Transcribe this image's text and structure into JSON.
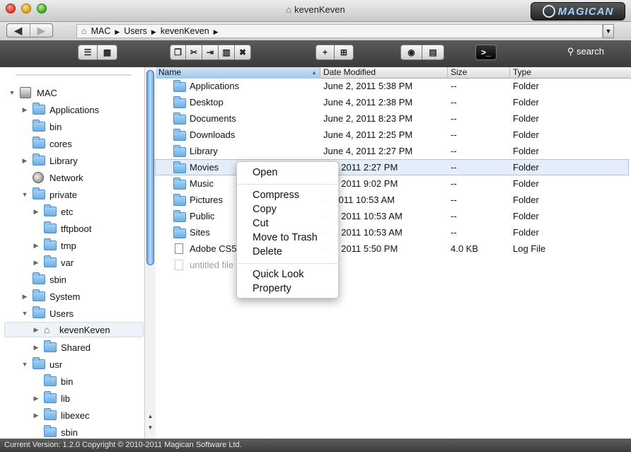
{
  "window": {
    "title": "kevenKeven",
    "brand": "MAGICAN"
  },
  "path": {
    "segments": [
      "MAC",
      "Users",
      "kevenKeven"
    ]
  },
  "toolbar": {
    "search_label": "search"
  },
  "sidebar": {
    "items": [
      {
        "label": "MAC"
      },
      {
        "label": "Applications"
      },
      {
        "label": "bin"
      },
      {
        "label": "cores"
      },
      {
        "label": "Library"
      },
      {
        "label": "Network"
      },
      {
        "label": "private"
      },
      {
        "label": "etc"
      },
      {
        "label": "tftpboot"
      },
      {
        "label": "tmp"
      },
      {
        "label": "var"
      },
      {
        "label": "sbin"
      },
      {
        "label": "System"
      },
      {
        "label": "Users"
      },
      {
        "label": "kevenKeven"
      },
      {
        "label": "Shared"
      },
      {
        "label": "usr"
      },
      {
        "label": "bin"
      },
      {
        "label": "lib"
      },
      {
        "label": "libexec"
      },
      {
        "label": "sbin"
      }
    ]
  },
  "columns": [
    "Name",
    "Date Modified",
    "Size",
    "Type"
  ],
  "files": [
    {
      "name": "Applications",
      "date": "June 2, 2011 5:38 PM",
      "size": "--",
      "type": "Folder"
    },
    {
      "name": "Desktop",
      "date": "June 4, 2011 2:38 PM",
      "size": "--",
      "type": "Folder"
    },
    {
      "name": "Documents",
      "date": "June 2, 2011 8:23 PM",
      "size": "--",
      "type": "Folder"
    },
    {
      "name": "Downloads",
      "date": "June 4, 2011 2:25 PM",
      "size": "--",
      "type": "Folder"
    },
    {
      "name": "Library",
      "date": "June 4, 2011 2:27 PM",
      "size": "--",
      "type": "Folder"
    },
    {
      "name": "Movies",
      "date": "e 4, 2011 2:27 PM",
      "size": "--",
      "type": "Folder"
    },
    {
      "name": "Music",
      "date": "e 2, 2011 9:02 PM",
      "size": "--",
      "type": "Folder"
    },
    {
      "name": "Pictures",
      "date": "2, 2011 10:53 AM",
      "size": "--",
      "type": "Folder"
    },
    {
      "name": "Public",
      "date": "e 2, 2011 10:53 AM",
      "size": "--",
      "type": "Folder"
    },
    {
      "name": "Sites",
      "date": "e 2, 2011 10:53 AM",
      "size": "--",
      "type": "Folder"
    },
    {
      "name": "Adobe CS5",
      "date": "e 2, 2011 5:50 PM",
      "size": "4.0 KB",
      "type": "Log File"
    },
    {
      "name": "untitled file",
      "date": "",
      "size": "",
      "type": ""
    }
  ],
  "context_menu": {
    "open": "Open",
    "compress": "Compress",
    "copy": "Copy",
    "cut": "Cut",
    "move_to_trash": "Move to Trash",
    "delete": "Delete",
    "quick_look": "Quick Look",
    "property": "Property"
  },
  "status": "Current Version: 1.2.0 Copyright © 2010-2011 Magican Software Ltd."
}
